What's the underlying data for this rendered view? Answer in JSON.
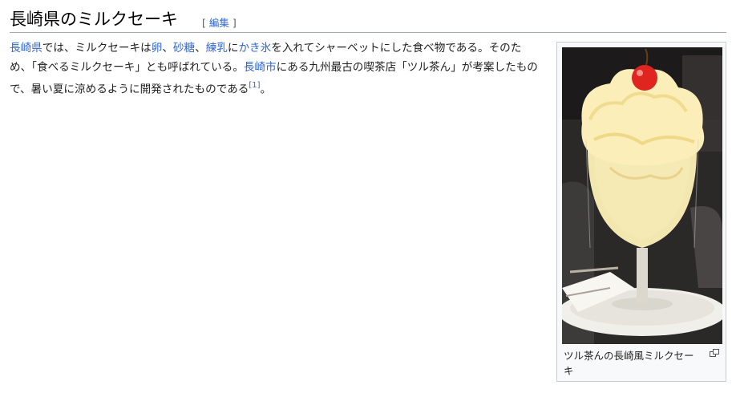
{
  "section": {
    "title": "長崎県のミルクセーキ",
    "edit_open": "[",
    "edit_label": "編集",
    "edit_close": "]"
  },
  "paragraph": {
    "seg1_link": "長崎県",
    "seg2": "では、ミルクセーキは",
    "seg3_link": "卵",
    "seg4": "、",
    "seg5_link": "砂糖",
    "seg6": "、",
    "seg7_link": "練乳",
    "seg8": "に",
    "seg9_link": "かき氷",
    "seg10": "を入れてシャーベットにした食べ物である。そのため、「食べるミルクセーキ」とも呼ばれている。",
    "seg11_link": "長崎市",
    "seg12": "にある九州最古の喫茶店「ツル茶ん」が考案したもので、暑い夏に涼めるように開発されたものである",
    "ref": "[1]",
    "seg13": "。"
  },
  "thumb": {
    "caption": "ツル茶んの長崎風ミルクセーキ",
    "magnify_icon": "magnify-clip-icon"
  }
}
